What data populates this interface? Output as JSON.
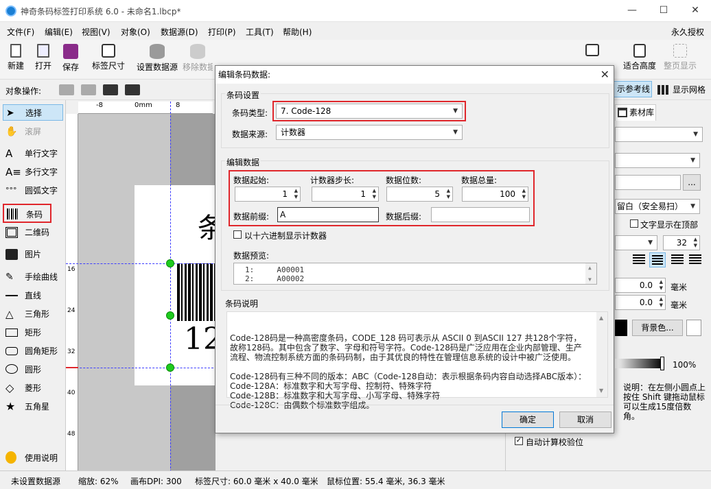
{
  "window": {
    "title": "神奇条码标签打印系统 6.0 - 未命名1.lbcp*",
    "minimize": "—",
    "maximize": "☐",
    "close": "✕"
  },
  "menu": {
    "items": [
      "文件(F)",
      "编辑(E)",
      "视图(V)",
      "对象(O)",
      "数据源(D)",
      "打印(P)",
      "工具(T)",
      "帮助(H)"
    ],
    "license": "永久授权"
  },
  "toolbar": {
    "new": "新建",
    "open": "打开",
    "save": "保存",
    "label_size": "标签尺寸",
    "set_datasource": "设置数据源",
    "remove_datasource": "移除数据源",
    "fit_height": "适合高度",
    "full_page": "整页显示"
  },
  "objbar": {
    "label": "对象操作:",
    "show_ref_lines": "示参考线",
    "show_grid": "显示网格"
  },
  "tools": {
    "select": "选择",
    "scroll": "滚屏",
    "single_text": "单行文字",
    "multi_text": "多行文字",
    "arc_text": "圆弧文字",
    "barcode": "条码",
    "qrcode": "二维码",
    "image": "图片",
    "freehand": "手绘曲线",
    "line": "直线",
    "triangle": "三角形",
    "rectangle": "矩形",
    "round_rect": "圆角矩形",
    "circle": "圆形",
    "diamond": "菱形",
    "star": "五角星",
    "help": "使用说明"
  },
  "ruler": {
    "h_ticks": [
      "-8",
      "0mm",
      "8"
    ],
    "v_ticks": [
      "16",
      "24",
      "32",
      "40",
      "48"
    ]
  },
  "canvas": {
    "label_text_partial": "条",
    "barcode_digits_partial": "12"
  },
  "right_panel": {
    "material_lib": "素材库",
    "quiet_zone": "留白（安全易扫）",
    "text_on_top": "文字显示在顶部",
    "font_size": "32",
    "offset_x": "0.0",
    "offset_y": "0.0",
    "unit": "毫米",
    "bg_color_btn": "背景色...",
    "opacity": "100%",
    "note": "说明：在左侧小圆点上按住 Shift 键拖动鼠标可以生成15度倍数角。",
    "auto_check_digit": "自动计算校验位",
    "browse_btn": "..."
  },
  "status": {
    "datasource": "未设置数据源",
    "zoom": "缩放: 62%",
    "dpi": "画布DPI: 300",
    "label_size": "标签尺寸: 60.0 毫米 x 40.0 毫米",
    "mouse_pos": "鼠标位置: 55.4 毫米, 36.3 毫米"
  },
  "dialog": {
    "title": "编辑条码数据:",
    "close": "✕",
    "barcode_settings": {
      "group": "条码设置",
      "type_label": "条码类型:",
      "type_value": "7. Code-128",
      "source_label": "数据来源:",
      "source_value": "计数器"
    },
    "edit_data": {
      "group": "编辑数据",
      "start_label": "数据起始:",
      "start_value": "1",
      "step_label": "计数器步长:",
      "step_value": "1",
      "digits_label": "数据位数:",
      "digits_value": "5",
      "total_label": "数据总量:",
      "total_value": "100",
      "prefix_label": "数据前缀:",
      "prefix_value": "A",
      "suffix_label": "数据后缀:",
      "suffix_value": "",
      "hex_checkbox": "以十六进制显示计数器",
      "preview_label": "数据预览:",
      "preview_rows": [
        "1:     A00001",
        "2:     A00002"
      ]
    },
    "description": {
      "group": "条码说明",
      "text": "Code-128码是一种高密度条码，CODE_128 码可表示从 ASCII 0 到ASCII 127 共128个字符，故称128码。其中包含了数字、字母和符号字符。Code-128码是广泛应用在企业内部管理、生产流程、物流控制系统方面的条码码制，由于其优良的特性在管理信息系统的设计中被广泛使用。\n\nCode-128码有三种不同的版本：ABC（Code-128自动：表示根据条码内容自动选择ABC版本）：\nCode-128A：标准数字和大写字母、控制符、特殊字符\nCode-128B：标准数字和大写字母、小写字母、特殊字符\nCode-128C：由偶数个标准数字组成。"
    },
    "ok": "确定",
    "cancel": "取消"
  },
  "colors": {
    "accent": "#0078d7",
    "highlight": "#e0262b",
    "handle": "#1ecb1e"
  }
}
